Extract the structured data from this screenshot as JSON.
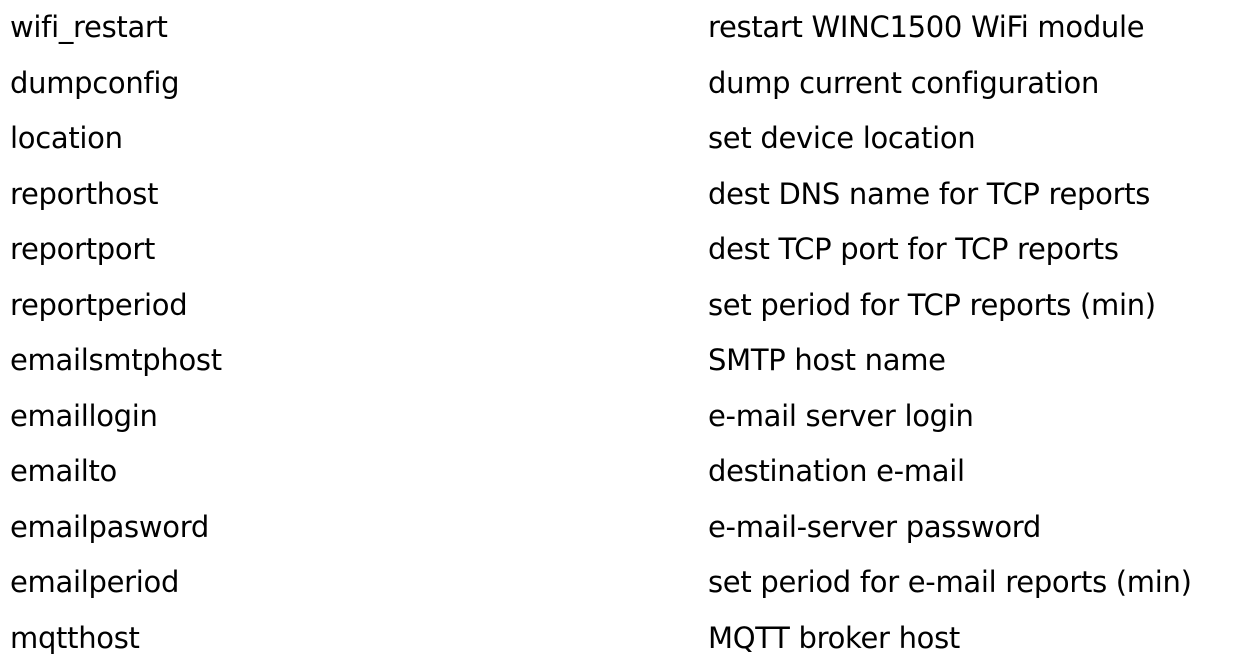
{
  "commands": [
    {
      "name": "wifi_restart",
      "description": "restart WINC1500 WiFi module"
    },
    {
      "name": "dumpconfig",
      "description": "dump current configuration"
    },
    {
      "name": "location",
      "description": "set device location"
    },
    {
      "name": "reporthost",
      "description": "dest DNS name for TCP reports"
    },
    {
      "name": "reportport",
      "description": "dest TCP port for TCP reports"
    },
    {
      "name": "reportperiod",
      "description": "set period for TCP reports (min)"
    },
    {
      "name": "emailsmtphost",
      "description": "SMTP host name"
    },
    {
      "name": "emaillogin",
      "description": "e-mail server login"
    },
    {
      "name": "emailto",
      "description": "destination e-mail"
    },
    {
      "name": "emailpasword",
      "description": "e-mail-server password"
    },
    {
      "name": "emailperiod",
      "description": "set period for e-mail reports (min)"
    },
    {
      "name": "mqtthost",
      "description": "MQTT broker host"
    }
  ]
}
